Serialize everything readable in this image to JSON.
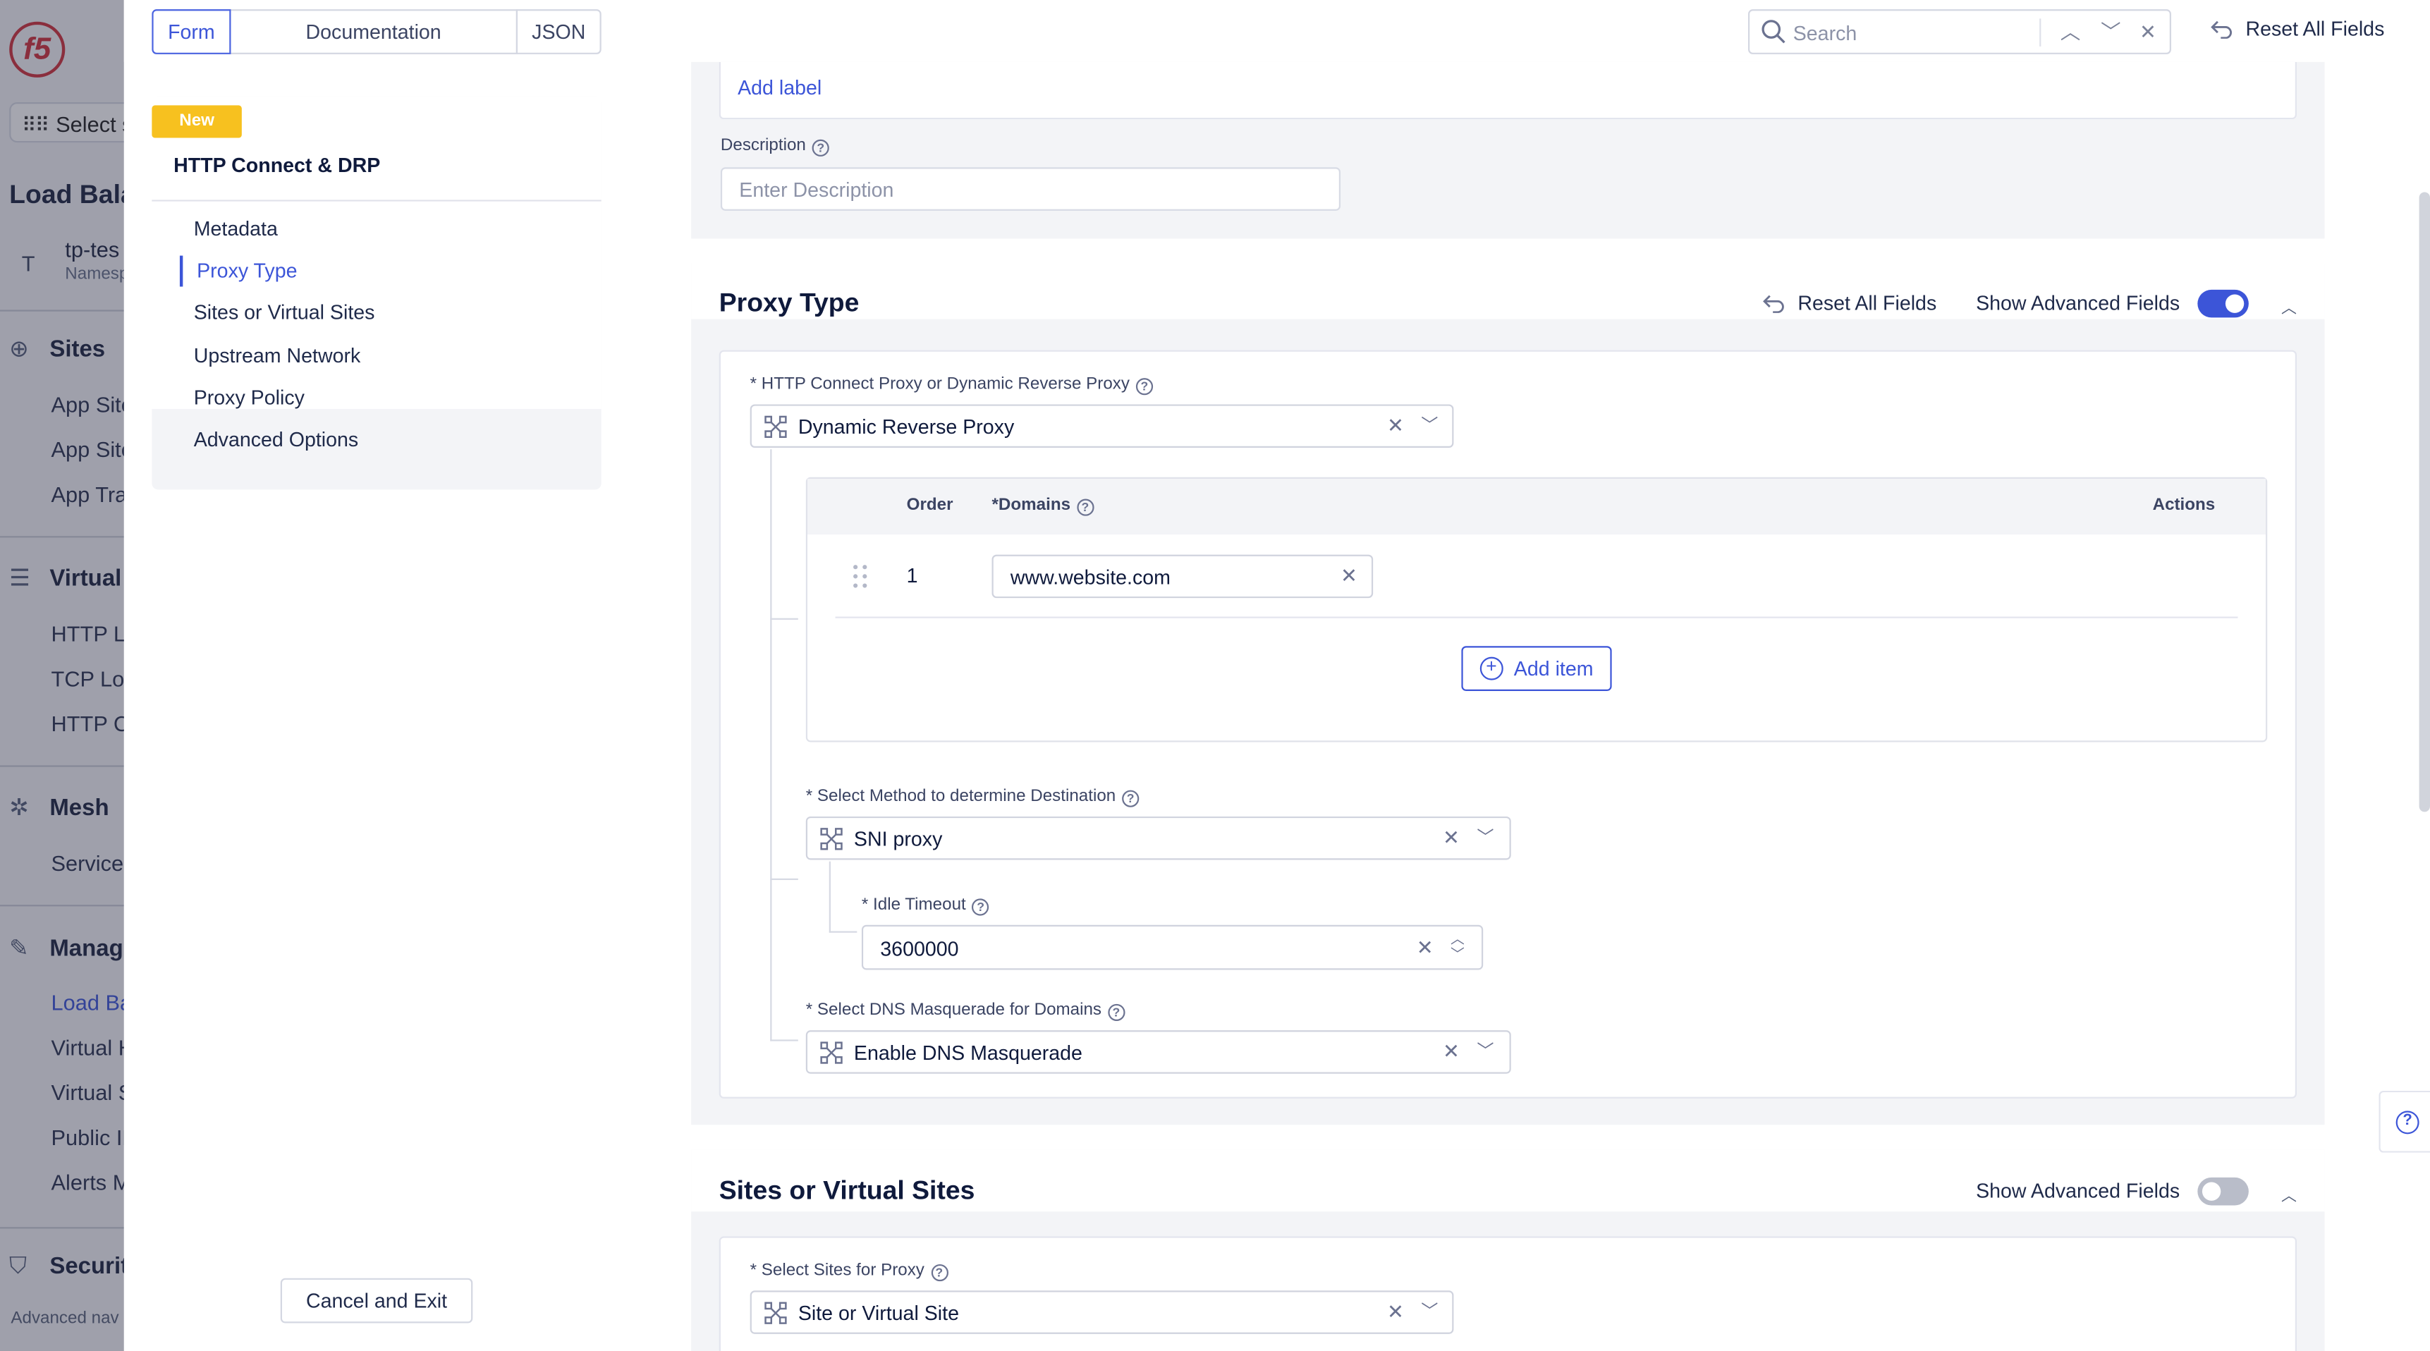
{
  "nav": {
    "select_label": "Select s",
    "page_heading": "Load Bala",
    "namespace": {
      "initial": "T",
      "name": "tp-tes",
      "type": "Namesp"
    },
    "sections": [
      {
        "label": "Sites",
        "icon": "globe-icon"
      },
      {
        "label": "Virtual",
        "icon": "sliders-icon"
      },
      {
        "label": "Mesh",
        "icon": "mesh-icon"
      },
      {
        "label": "Manag",
        "icon": "wrench-icon"
      },
      {
        "label": "Securit",
        "icon": "shield-icon"
      }
    ],
    "items": {
      "sites": [
        "App Site",
        "App Site",
        "App Tra"
      ],
      "virtual": [
        "HTTP Lo",
        "TCP Loa",
        "HTTP C"
      ],
      "mesh": [
        "Service"
      ],
      "manage": [
        "Load Ba",
        "Virtual H",
        "Virtual S",
        "Public IP",
        "Alerts M"
      ]
    },
    "advanced_nav": "Advanced nav"
  },
  "toolbar": {
    "tabs": [
      "Form",
      "Documentation",
      "JSON"
    ],
    "active_tab": "Form",
    "search_placeholder": "Search",
    "reset_all": "Reset All Fields"
  },
  "steps": {
    "badge": "New",
    "title": "HTTP Connect & DRP",
    "items": [
      "Metadata",
      "Proxy Type",
      "Sites or Virtual Sites",
      "Upstream Network",
      "Proxy Policy",
      "Advanced Options"
    ],
    "active": "Proxy Type",
    "cancel": "Cancel and Exit"
  },
  "metadata": {
    "add_label": "Add label",
    "description_label": "Description",
    "description_placeholder": "Enter Description"
  },
  "proxy_type": {
    "title": "Proxy Type",
    "reset": "Reset All Fields",
    "show_advanced": "Show Advanced Fields",
    "advanced_enabled": true,
    "proxy_field_label": "* HTTP Connect Proxy or Dynamic Reverse Proxy",
    "proxy_value": "Dynamic Reverse Proxy",
    "domains_table": {
      "col_order": "Order",
      "col_domains": "*Domains",
      "col_actions": "Actions",
      "rows": [
        {
          "order": "1",
          "domain": "www.website.com"
        }
      ],
      "add_item": "Add item"
    },
    "method_label": "* Select Method to determine Destination",
    "method_value": "SNI proxy",
    "idle_timeout_label": "* Idle Timeout",
    "idle_timeout_value": "3600000",
    "dns_label": "* Select DNS Masquerade for Domains",
    "dns_value": "Enable DNS Masquerade"
  },
  "sites": {
    "title": "Sites or Virtual Sites",
    "show_advanced": "Show Advanced Fields",
    "advanced_enabled": false,
    "field_label": "* Select Sites for Proxy",
    "field_value": "Site or Virtual Site"
  },
  "colors": {
    "accent": "#3c55d8",
    "badge": "#f7c11f",
    "brand": "#d0313b"
  }
}
